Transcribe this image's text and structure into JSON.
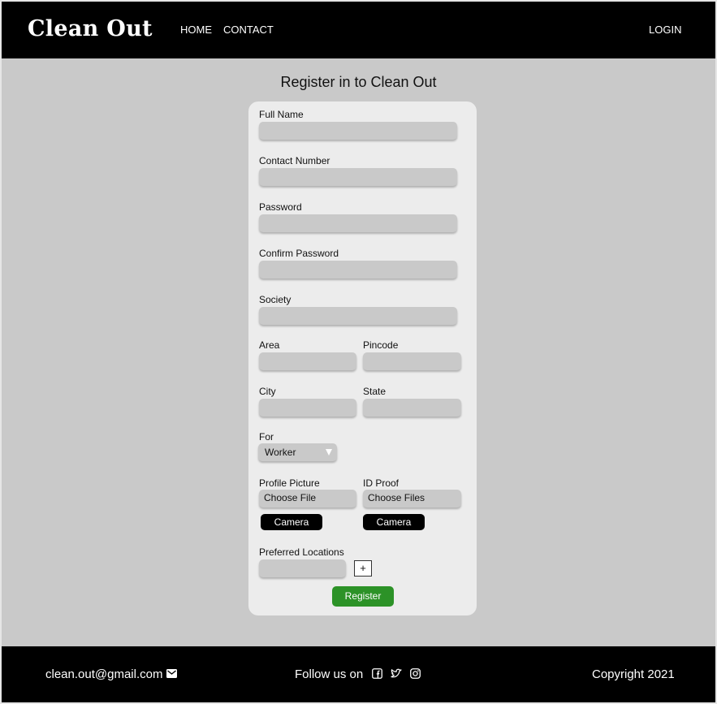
{
  "header": {
    "brand": "Clean Out",
    "nav": {
      "home": "HOME",
      "contact": "CONTACT",
      "login": "LOGIN"
    }
  },
  "page_title": "Register in to Clean Out",
  "form": {
    "full_name": {
      "label": "Full Name",
      "value": ""
    },
    "contact_number": {
      "label": "Contact Number",
      "value": ""
    },
    "password": {
      "label": "Password",
      "value": ""
    },
    "confirm_password": {
      "label": "Confirm Password",
      "value": ""
    },
    "society": {
      "label": "Society",
      "value": ""
    },
    "area": {
      "label": "Area",
      "value": ""
    },
    "pincode": {
      "label": "Pincode",
      "value": ""
    },
    "city": {
      "label": "City",
      "value": ""
    },
    "state": {
      "label": "State",
      "value": ""
    },
    "for": {
      "label": "For",
      "selected": "Worker"
    },
    "profile_picture": {
      "label": "Profile Picture",
      "button": "Choose File",
      "camera": "Camera"
    },
    "id_proof": {
      "label": "ID Proof",
      "button": "Choose Files",
      "camera": "Camera"
    },
    "preferred_locations": {
      "label": "Preferred Locations",
      "value": "",
      "add": "+"
    },
    "register": "Register"
  },
  "footer": {
    "email": "clean.out@gmail.com",
    "follow": "Follow us on",
    "copyright": "Copyright 2021",
    "icons": [
      "mail-icon",
      "facebook-icon",
      "twitter-icon",
      "instagram-icon"
    ]
  },
  "colors": {
    "header_bg": "#000000",
    "page_bg": "#c9c9c9",
    "card_bg": "#ececec",
    "register_button": "#2c9227"
  }
}
